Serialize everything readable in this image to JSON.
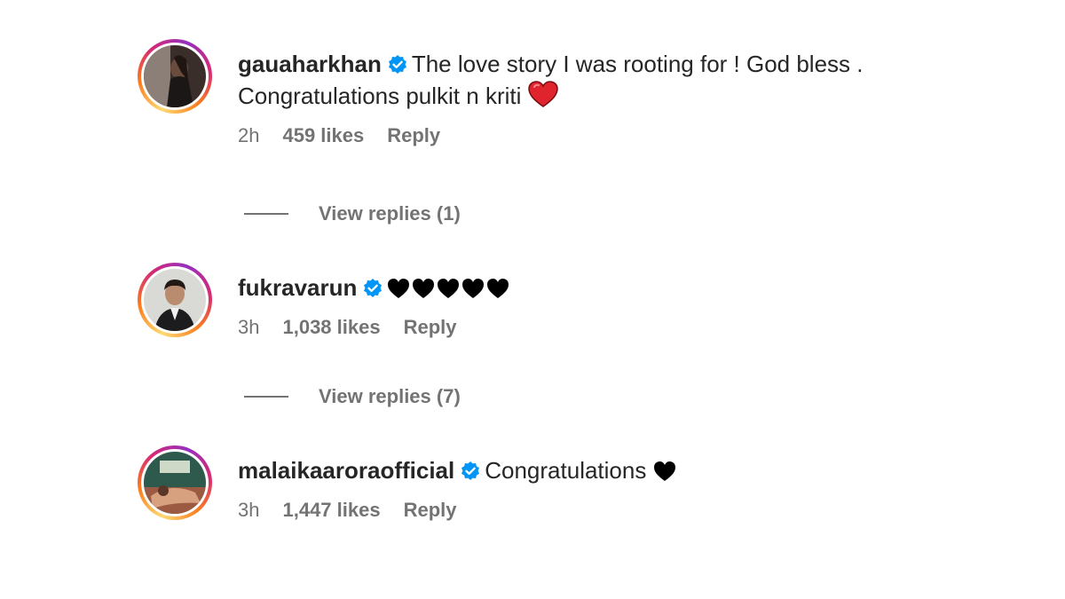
{
  "comments": [
    {
      "username": "gauaharkhan",
      "text_line1": "The love story I was rooting for ! God bless .",
      "text_line2": "Congratulations pulkit n kriti",
      "time": "2h",
      "likes": "459 likes",
      "reply": "Reply",
      "view_replies": "View replies (1)"
    },
    {
      "username": "fukravarun",
      "text": "",
      "time": "3h",
      "likes": "1,038 likes",
      "reply": "Reply",
      "view_replies": "View replies (7)"
    },
    {
      "username": "malaikaaroraofficial",
      "text": "Congratulations",
      "time": "3h",
      "likes": "1,447 likes",
      "reply": "Reply"
    }
  ],
  "colors": {
    "verified_blue": "#0095f6",
    "muted_text": "#737373",
    "primary_text": "#262626",
    "heart_red": "#e0242e"
  },
  "icons": [
    "verified-badge-icon",
    "red-heart-emoji",
    "black-heart-emoji"
  ]
}
